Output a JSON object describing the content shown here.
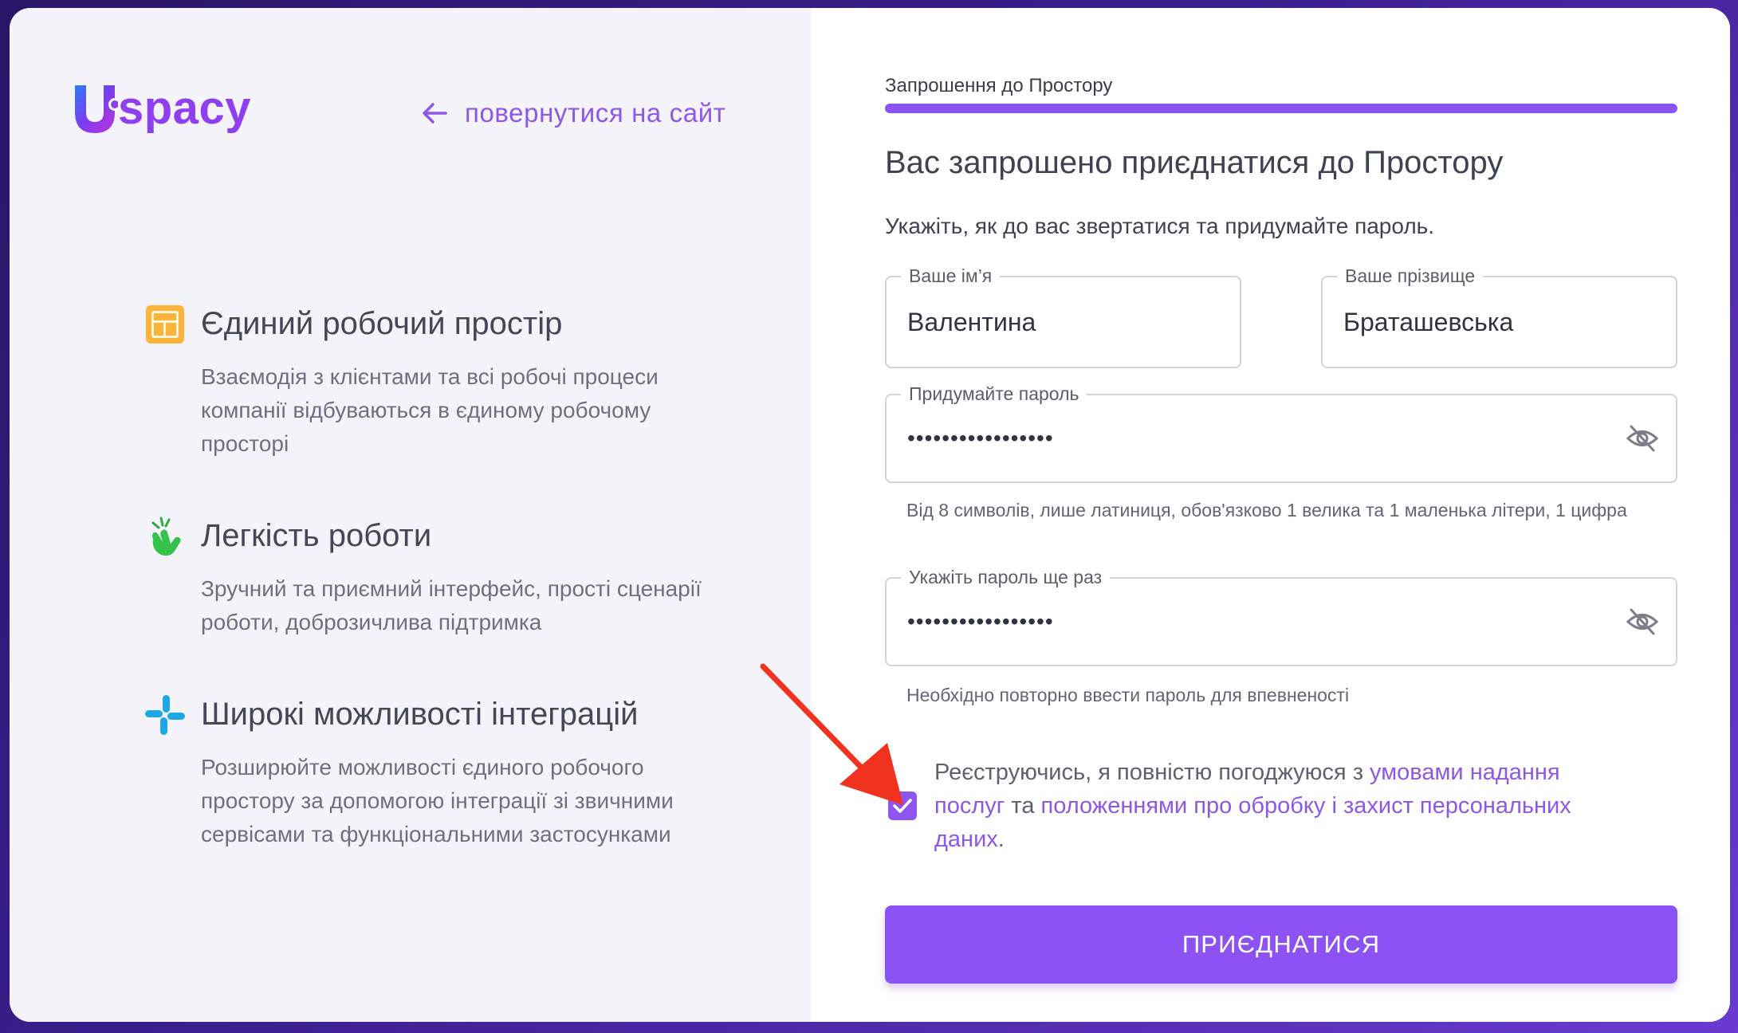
{
  "brand": {
    "logo_text": "spacy",
    "logo_colors": [
      "#2d7cf6",
      "#7a3df2",
      "#b13ad8"
    ],
    "accent": "#8d52f4"
  },
  "nav": {
    "back_label": "повернутися на сайт"
  },
  "features": [
    {
      "icon": "layout-grid-icon",
      "title": "Єдиний робочий простір",
      "description": "Взаємодія з клієнтами та всі робочі процеси компанії відбуваються в єдиному робочому просторі"
    },
    {
      "icon": "finger-snap-icon",
      "title": "Легкість роботи",
      "description": "Зручний та приємний інтерфейс, прості сценарії роботи, доброзичлива підтримка"
    },
    {
      "icon": "integrations-icon",
      "title": "Широкі можливості інтеграцій",
      "description": "Розширюйте можливості єдиного робочого простору за допомогою інтеграції зі звичними сервісами та функціональними застосунками"
    }
  ],
  "form": {
    "step_label": "Запрошення до Простору",
    "progress": 1.0,
    "heading": "Вас запрошено приєднатися до Простору",
    "subheading": "Укажіть, як до вас звертатися та придумайте пароль.",
    "first_name": {
      "label": "Ваше ім’я",
      "value": "Валентина"
    },
    "last_name": {
      "label": "Ваше прізвище",
      "value": "Браташевська"
    },
    "password": {
      "label": "Придумайте пароль",
      "value": "•••••••••••••••••",
      "hint": "Від 8 символів, лише латиниця, обов'язково 1 велика та 1 маленька літери, 1 цифра"
    },
    "password_confirm": {
      "label": "Укажіть пароль ще раз",
      "value": "•••••••••••••••••",
      "hint": "Необхідно повторно ввести пароль для впевненості"
    },
    "consent": {
      "checked": true,
      "text_before": "Реєструючись, я повністю погоджуюся з ",
      "terms_link": "умовами надання послуг",
      "text_middle": " та ",
      "privacy_link": "положеннями про обробку і захист персональних даних",
      "text_after": "."
    },
    "submit_label": "ПРИЄДНАТИСЯ"
  }
}
